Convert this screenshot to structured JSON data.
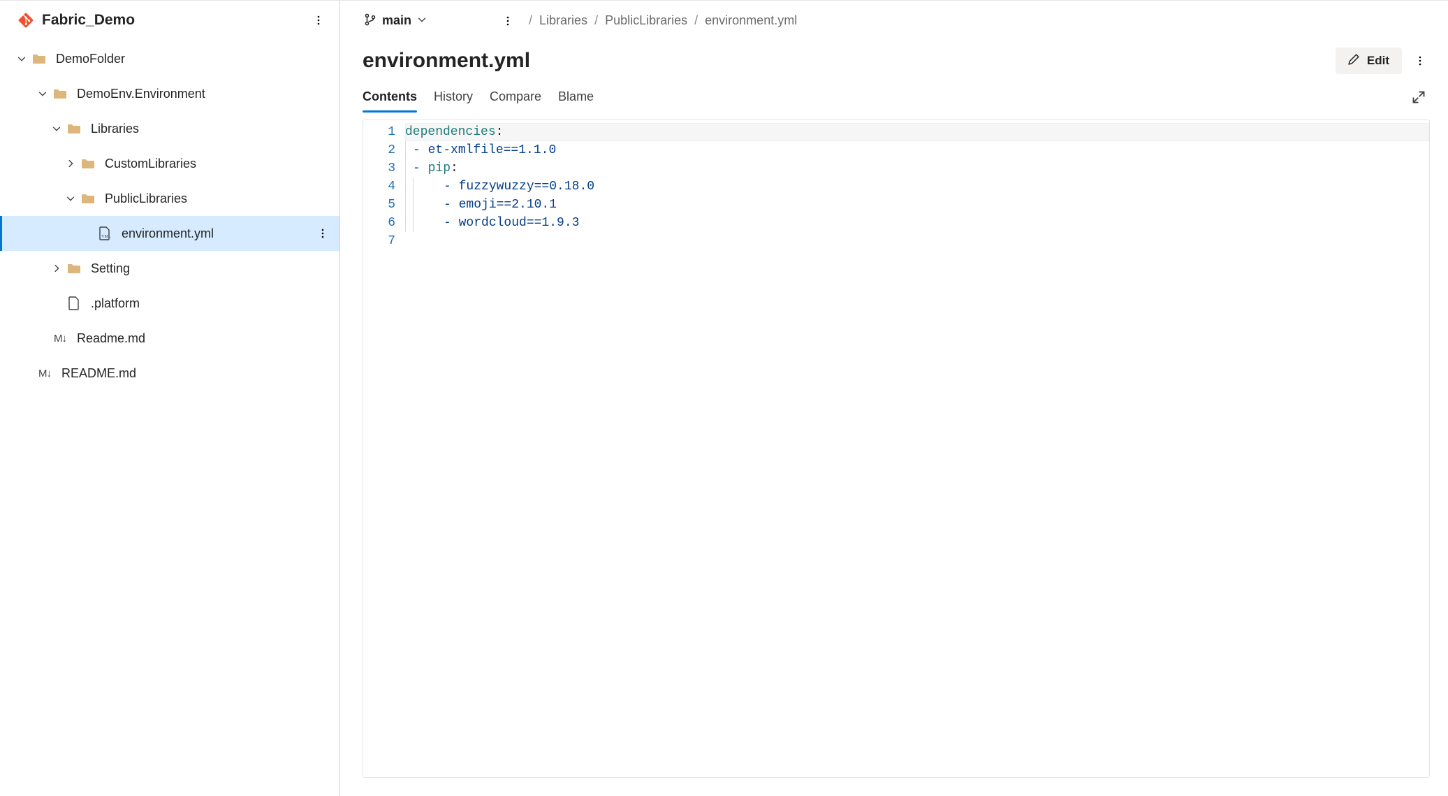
{
  "sidebar": {
    "repo_name": "Fabric_Demo",
    "tree": {
      "demo_folder": "DemoFolder",
      "demo_env": "DemoEnv.Environment",
      "libraries": "Libraries",
      "custom_libraries": "CustomLibraries",
      "public_libraries": "PublicLibraries",
      "environment_file": "environment.yml",
      "setting": "Setting",
      "platform": ".platform",
      "readme_inner": "Readme.md",
      "readme_root": "README.md"
    }
  },
  "main": {
    "branch": "main",
    "breadcrumb": {
      "c1": "Libraries",
      "c2": "PublicLibraries",
      "c3": "environment.yml"
    },
    "file_title": "environment.yml",
    "edit_label": "Edit",
    "tabs": {
      "contents": "Contents",
      "history": "History",
      "compare": "Compare",
      "blame": "Blame"
    },
    "code": {
      "line_numbers": [
        "1",
        "2",
        "3",
        "4",
        "5",
        "6",
        "7"
      ],
      "l1_key": "dependencies",
      "l1_colon": ":",
      "dash": "- ",
      "l2_val": "et-xmlfile==1.1.0",
      "l3_key": "pip",
      "l3_colon": ":",
      "l4_val": "fuzzywuzzy==0.18.0",
      "l5_val": "emoji==2.10.1",
      "l6_val": "wordcloud==1.9.3"
    }
  }
}
